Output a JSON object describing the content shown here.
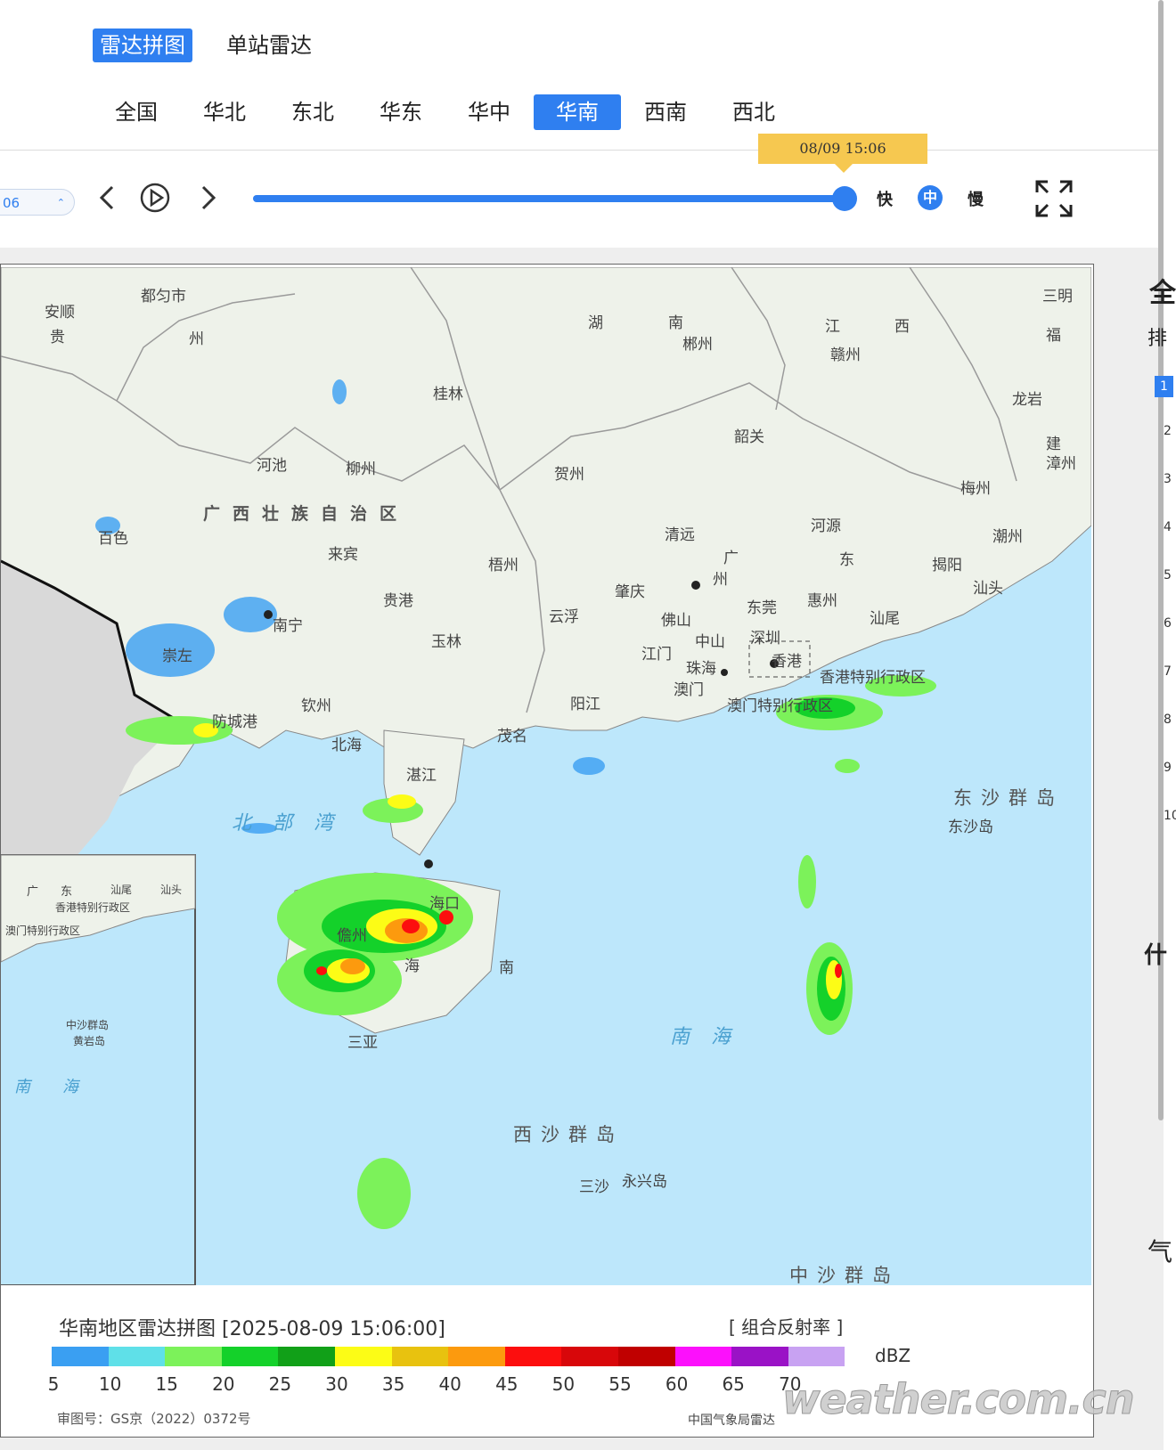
{
  "mode_tabs": [
    {
      "label": "雷达拼图",
      "active": true
    },
    {
      "label": "单站雷达",
      "active": false
    }
  ],
  "region_tabs": [
    {
      "label": "全国",
      "active": false
    },
    {
      "label": "华北",
      "active": false
    },
    {
      "label": "东北",
      "active": false
    },
    {
      "label": "华东",
      "active": false
    },
    {
      "label": "华中",
      "active": false
    },
    {
      "label": "华南",
      "active": true
    },
    {
      "label": "西南",
      "active": false
    },
    {
      "label": "西北",
      "active": false
    }
  ],
  "controls": {
    "time_select_value": "06",
    "timestamp_tooltip": "08/09 15:06",
    "progress": 1.0,
    "speed_fast": "快",
    "speed_medium": "中",
    "speed_slow": "慢",
    "icons": [
      "prev-icon",
      "play-icon",
      "next-icon",
      "fullscreen-icon"
    ]
  },
  "map": {
    "labels": {
      "anshun": "安顺",
      "duyun": "都匀市",
      "gui": "贵",
      "zhou": "州",
      "sanming": "三明",
      "hu": "湖",
      "nan": "南",
      "chenzhou": "郴州",
      "jiang": "江",
      "xi": "西",
      "ganzhou": "赣州",
      "fu": "福",
      "longyan": "龙岩",
      "guilin": "桂林",
      "shaoguan": "韶关",
      "jian": "建",
      "zhangzhou": "漳州",
      "hechi": "河池",
      "liuzhou": "柳州",
      "hezhou": "贺州",
      "meizhou": "梅州",
      "guangxi": "广西壮族自治区",
      "qingyuan": "清远",
      "heyuan": "河源",
      "chaozhou": "潮州",
      "baise": "百色",
      "laibin": "来宾",
      "wuzhou": "梧州",
      "guang": "广",
      "dong": "东",
      "guangzhou": "州",
      "jieyang": "揭阳",
      "shantou": "汕头",
      "guigang": "贵港",
      "zhaoqing": "肇庆",
      "huizhou": "惠州",
      "dongguan": "东莞",
      "nanning": "南宁",
      "yunfu": "云浮",
      "foshan": "佛山",
      "shanwei": "汕尾",
      "yulin": "玉林",
      "zhongshan": "中山",
      "shenzhen": "深圳",
      "chongzuo": "崇左",
      "jiangmen": "江门",
      "zhuhai": "珠海",
      "hongkong": "香港",
      "hk_sar": "香港特别行政区",
      "macao": "澳门",
      "macao_sar": "澳门特别行政区",
      "fangchenggang": "防城港",
      "qinzhou": "钦州",
      "yangjiang": "阳江",
      "beihai": "北海",
      "maoming": "茂名",
      "dongsha": "东沙群岛",
      "dongsha_island": "东沙岛",
      "zhanjiang": "湛江",
      "beibu": "北部湾",
      "haikou": "海口",
      "danzhou": "儋州",
      "hai": "海",
      "nan2": "南",
      "nanhai": "南海",
      "sanya": "三亚",
      "xisha": "西沙群岛",
      "sansha": "三沙",
      "yongxing": "永兴岛",
      "zhongsha": "中沙群岛",
      "inset_guang": "广",
      "inset_dong": "东",
      "inset_shanwei": "汕尾",
      "inset_shantou": "汕头",
      "inset_hk": "香港特别行政区",
      "inset_macao": "澳门特别行政区",
      "inset_zhongsha": "中沙群岛",
      "inset_huangyan": "黄岩岛",
      "inset_nanhai": "南海"
    }
  },
  "legend": {
    "title": "华南地区雷达拼图 [2025-08-09 15:06:00]",
    "type": "[ 组合反射率 ]",
    "unit": "dBZ",
    "colors": [
      "#3a9ff2",
      "#5fe0e8",
      "#7cf25a",
      "#14d12a",
      "#11a018",
      "#fcfc16",
      "#e8c20f",
      "#fc9a0e",
      "#fc0e0e",
      "#d8070a",
      "#c00000",
      "#fc10fc",
      "#9a12c6",
      "#c8a2f2"
    ],
    "ticks": [
      "5",
      "10",
      "15",
      "20",
      "25",
      "30",
      "35",
      "40",
      "45",
      "50",
      "55",
      "60",
      "65",
      "70"
    ],
    "approval": "审图号：GS京（2022）0372号",
    "source": "中国气象局雷达",
    "watermark": "weather.com.cn"
  },
  "sidebar": {
    "title_partial": "全",
    "rank_partial": "排",
    "ranks": [
      "1",
      "2",
      "3",
      "4",
      "5",
      "6",
      "7",
      "8",
      "9",
      "10"
    ],
    "what_partial": "什",
    "weather_partial": "气"
  }
}
